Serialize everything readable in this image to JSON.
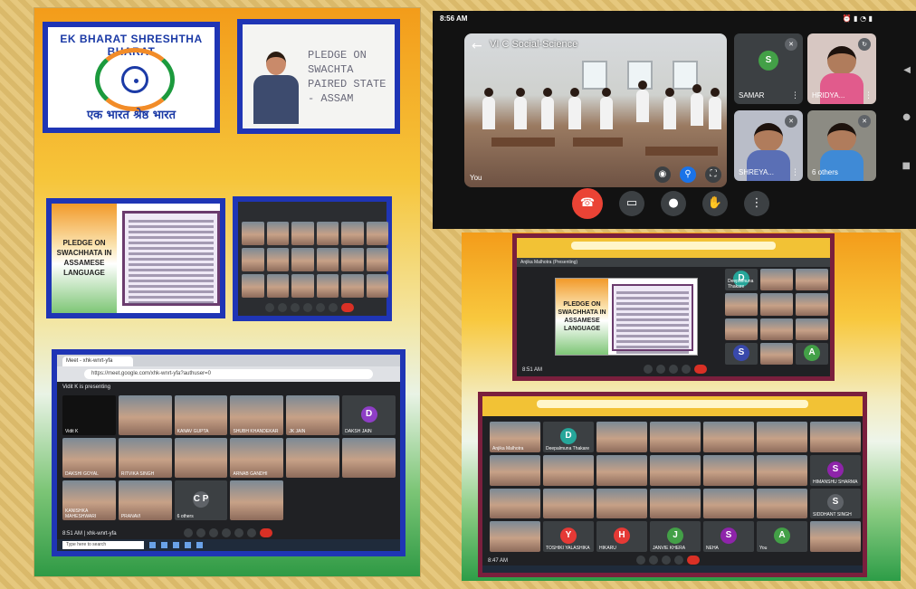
{
  "left_collage": {
    "logo": {
      "title": "EK BHARAT SHRESHTHA BHARAT",
      "hindi": "एक भारत श्रेष्ठ भारत"
    },
    "teacher_board": {
      "line1": "PLEDGE ON SWACHTA",
      "line2": "PAIRED STATE - ASSAM"
    },
    "pledge_title": "PLEDGE ON SWACHHATA IN ASSAMESE LANGUAGE",
    "meet2": {
      "tab_label": "Meet - xhk-wnrt-yfa",
      "url": "https://meet.google.com/xhk-wnrt-yfa?authuser=0",
      "presenting": "Vidit K is presenting",
      "time": "8:51 AM | xhk-wnrt-yfa",
      "search": "Type here to search",
      "tiles": [
        {
          "name": "Vidit K",
          "type": "present"
        },
        {
          "name": "",
          "type": "person"
        },
        {
          "name": "KANAV GUPTA",
          "type": "person"
        },
        {
          "name": "SHUBH KHANDEKAR",
          "type": "person"
        },
        {
          "name": "JK JAIN",
          "type": "person"
        },
        {
          "name": "DAKSH JAIN",
          "type": "avatar",
          "letter": "D",
          "color": "#8e3ec6"
        },
        {
          "name": "DAKSHI GOYAL",
          "type": "person"
        },
        {
          "name": "RITVIKA SINGH",
          "type": "person"
        },
        {
          "name": "",
          "type": "person"
        },
        {
          "name": "ARNAB GANDHI",
          "type": "person"
        },
        {
          "name": "",
          "type": "person"
        },
        {
          "name": "",
          "type": "person"
        },
        {
          "name": "KANISHKA MAHESHWARI",
          "type": "person"
        },
        {
          "name": "PRANAVI",
          "type": "person"
        },
        {
          "name": "6 others",
          "type": "avatar",
          "letter": "C P",
          "color": "#5f6368"
        },
        {
          "name": "",
          "type": "person"
        }
      ]
    },
    "meet1_names": [
      "",
      "",
      "",
      "",
      "",
      "",
      "",
      "",
      "",
      "",
      "",
      "",
      "",
      "",
      "",
      "",
      "",
      "",
      "",
      "",
      "",
      "",
      "",
      ""
    ]
  },
  "phone": {
    "time": "8:56 AM",
    "class_name": "VI C Social-Science",
    "you_label": "You",
    "participants": [
      {
        "name": "SAMAR",
        "letter": "S",
        "color": "#43a047"
      },
      {
        "name": "HRIDYA...",
        "color": "#e15b8c"
      },
      {
        "name": "SHREYA...",
        "color": "#5a6fb5"
      },
      {
        "name": "6 others",
        "color": "#3f8ad6"
      }
    ],
    "extra_label": "AN"
  },
  "right_meet1": {
    "presenter": "Anjika Malhotra (Presenting)",
    "pledge_title": "PLEDGE ON SWACHHATA IN ASSAMESE LANGUAGE",
    "time": "8:51 AM",
    "mid_tiles": [
      {
        "name": "Deepalmuna Thakare",
        "letter": "D",
        "color": "#26a69a"
      },
      {
        "name": "",
        "letter": "S",
        "color": "#3949ab"
      },
      {
        "name": "",
        "letter": "A",
        "color": "#43a047"
      }
    ]
  },
  "right_meet2": {
    "time": "8:47 AM",
    "url": "https://meet.google.com/xhk-wnrt-yfa",
    "row1": [
      {
        "name": "Anjika Malhotra",
        "letter": "",
        "color": ""
      },
      {
        "name": "Deepalmuna Thakare",
        "letter": "D",
        "color": "#26a69a"
      },
      {
        "name": "",
        "letter": "",
        "color": ""
      },
      {
        "name": "",
        "letter": "",
        "color": ""
      },
      {
        "name": "",
        "letter": "",
        "color": ""
      },
      {
        "name": "",
        "letter": "",
        "color": ""
      },
      {
        "name": "",
        "letter": "",
        "color": ""
      }
    ],
    "bottom_row": [
      {
        "name": "TOSHIKI YALASHIKA",
        "letter": "Y",
        "color": "#e53935"
      },
      {
        "name": "HIKARU",
        "letter": "H",
        "color": "#e53935"
      },
      {
        "name": "JANVIE KHERA",
        "letter": "J",
        "color": "#43a047"
      },
      {
        "name": "NEHA",
        "letter": "S",
        "color": "#8e24aa"
      },
      {
        "name": "You",
        "letter": "A",
        "color": "#43a047"
      }
    ],
    "right_col": [
      {
        "name": "HIMANSHU SHARMA",
        "letter": "S",
        "color": "#8e24aa"
      },
      {
        "name": "SIDDHANT SINGH",
        "letter": "S",
        "color": "#5f6368"
      }
    ]
  }
}
